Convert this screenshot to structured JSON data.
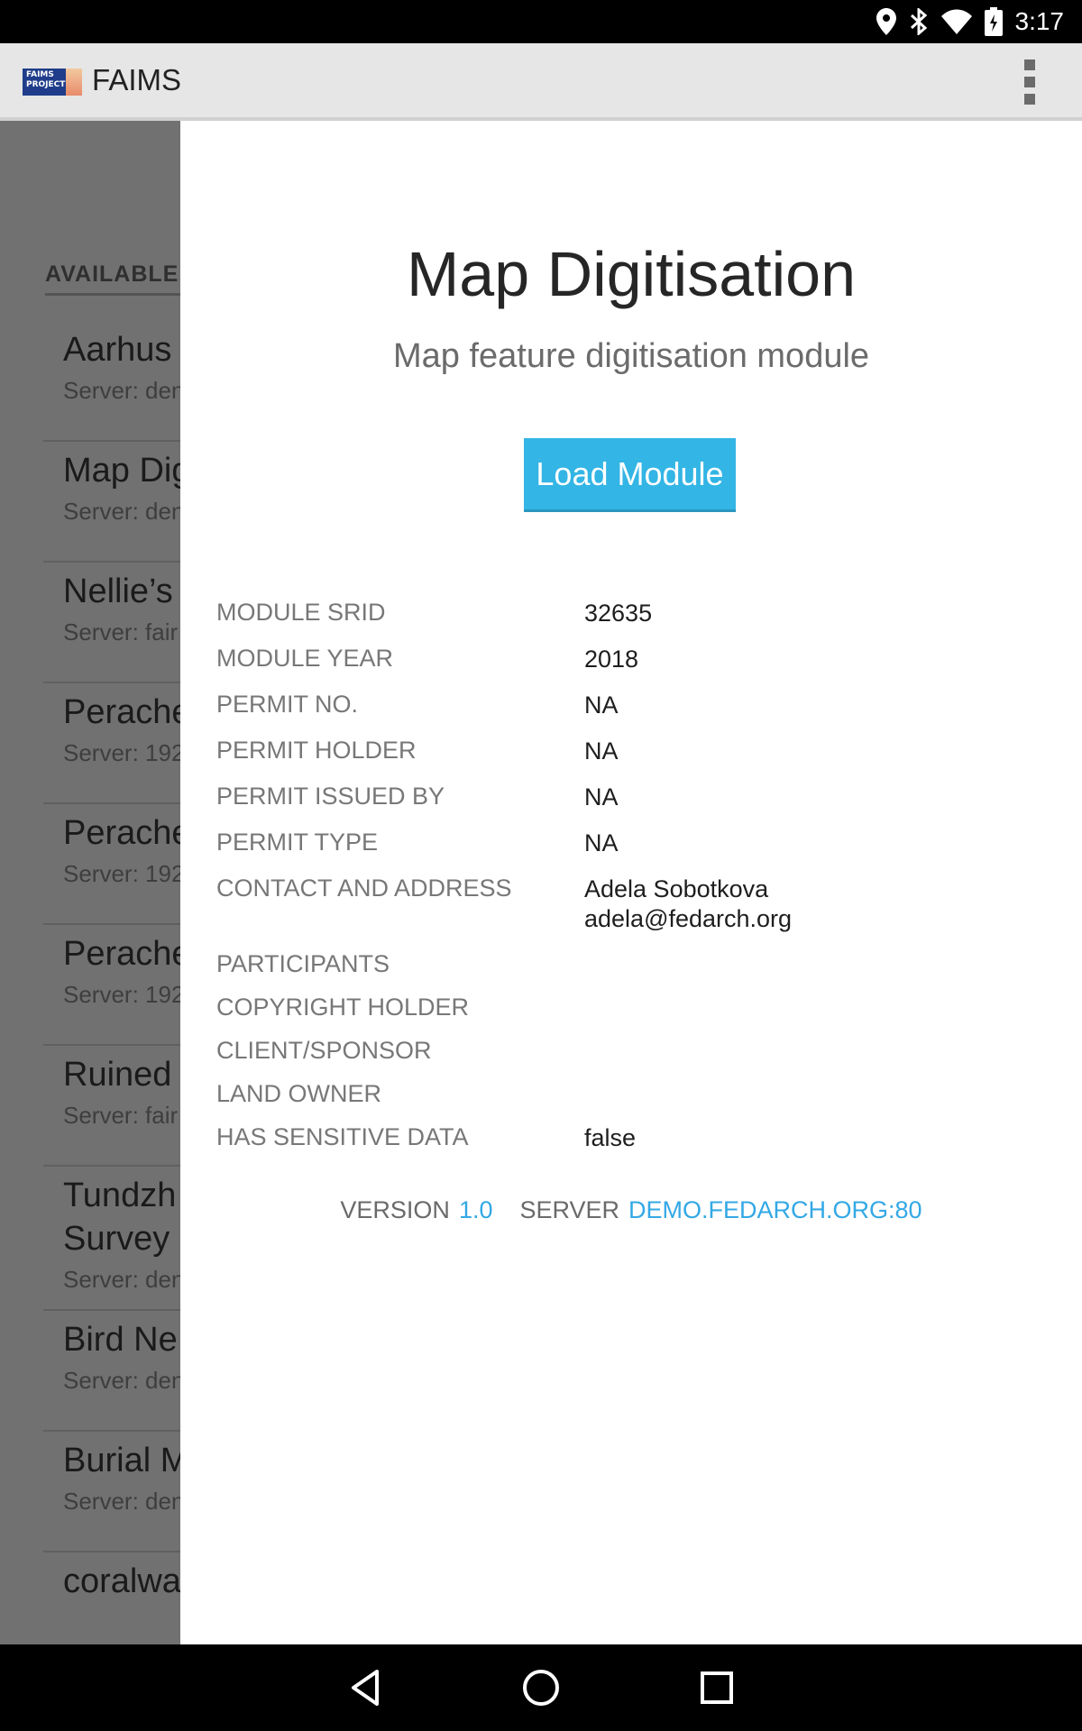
{
  "status_bar": {
    "time": "3:17",
    "icons": [
      "location-icon",
      "bluetooth-icon",
      "wifi-icon",
      "battery-icon"
    ]
  },
  "app_bar": {
    "title": "FAIMS",
    "logo_text": "FAIMS PROJECT"
  },
  "background_list": {
    "section_header": "AVAILABLE",
    "items": [
      {
        "name": "Aarhus",
        "server": "Server: den"
      },
      {
        "name": "Map Dig",
        "server": "Server: den"
      },
      {
        "name": "Nellie’s",
        "server": "Server: fair"
      },
      {
        "name": "Perache",
        "server": "Server: 192"
      },
      {
        "name": "Perache",
        "server": "Server: 192"
      },
      {
        "name": "Perache",
        "server": "Server: 192"
      },
      {
        "name": "Ruined",
        "server": "Server: fair"
      },
      {
        "name": "Tundzh\nSurvey",
        "server": "Server: den"
      },
      {
        "name": "Bird Ne",
        "server": "Server: den"
      },
      {
        "name": "Burial M",
        "server": "Server: den"
      },
      {
        "name": "coralwa",
        "server": ""
      }
    ]
  },
  "module": {
    "title": "Map Digitisation",
    "subtitle": "Map feature digitisation module",
    "load_button": "Load Module",
    "details": [
      {
        "label": "MODULE SRID",
        "value": "32635"
      },
      {
        "label": "MODULE YEAR",
        "value": "2018"
      },
      {
        "label": "PERMIT NO.",
        "value": "NA"
      },
      {
        "label": "PERMIT HOLDER",
        "value": "NA"
      },
      {
        "label": "PERMIT ISSUED BY",
        "value": "NA"
      },
      {
        "label": "PERMIT TYPE",
        "value": "NA"
      },
      {
        "label": "CONTACT AND ADDRESS",
        "value": "Adela Sobotkova\nadela@fedarch.org"
      },
      {
        "label": "PARTICIPANTS",
        "value": ""
      },
      {
        "label": "COPYRIGHT HOLDER",
        "value": ""
      },
      {
        "label": "CLIENT/SPONSOR",
        "value": ""
      },
      {
        "label": "LAND OWNER",
        "value": ""
      },
      {
        "label": "HAS SENSITIVE DATA",
        "value": "false"
      }
    ],
    "footer": {
      "version_label": "VERSION",
      "version_value": "1.0",
      "server_label": "SERVER",
      "server_value": "DEMO.FEDARCH.ORG:80"
    }
  },
  "colors": {
    "accent": "#33b5e5",
    "app_bar": "#e6e6e6",
    "scrim": "#717171"
  }
}
